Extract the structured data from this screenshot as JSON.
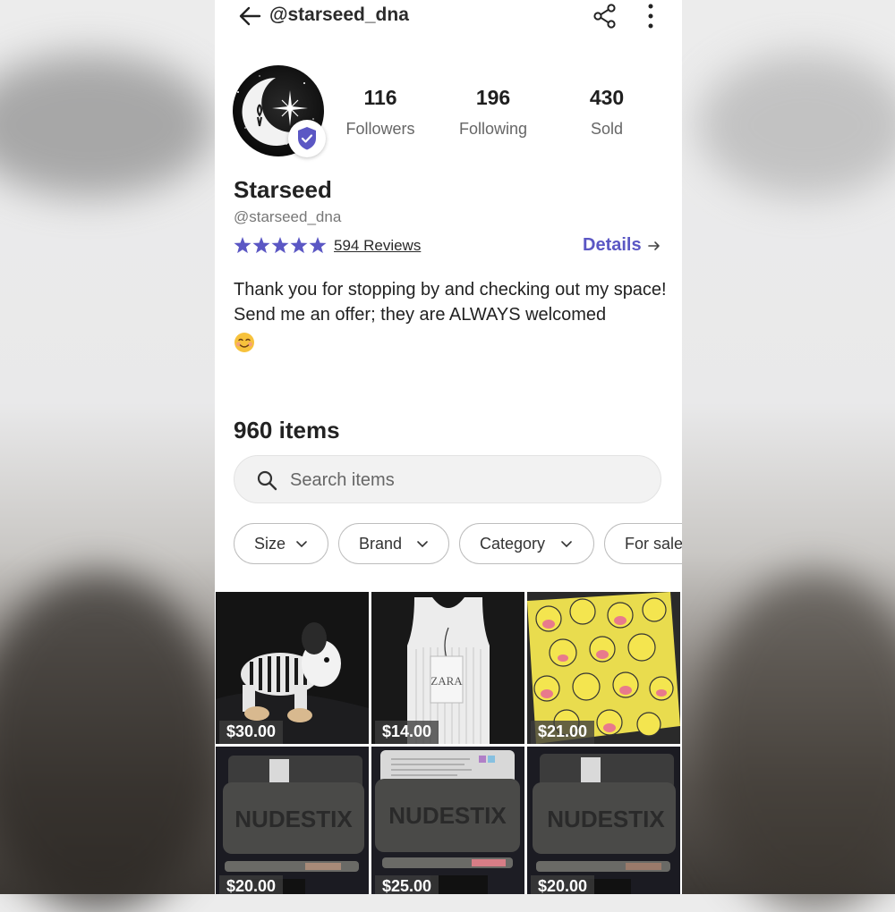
{
  "header": {
    "handle": "@starseed_dna"
  },
  "profile": {
    "stats": [
      {
        "value": "116",
        "label": "Followers"
      },
      {
        "value": "196",
        "label": "Following"
      },
      {
        "value": "430",
        "label": "Sold"
      }
    ],
    "name": "Starseed",
    "handle": "@starseed_dna",
    "rating": 5,
    "reviews_label": "594 Reviews",
    "details_label": "Details",
    "bio": "Thank you for stopping by and checking out my space! Send me an offer; they are ALWAYS welcomed",
    "accent_color": "#5b57c4",
    "verified": true
  },
  "items": {
    "count_label": "960 items",
    "search_placeholder": "Search items",
    "filters": [
      "Size",
      "Brand",
      "Category",
      "For sale"
    ],
    "listings": [
      {
        "price": "$30.00",
        "thumbnail": "skeleton-elephant-toy"
      },
      {
        "price": "$14.00",
        "thumbnail": "white-ribbed-tank-top"
      },
      {
        "price": "$21.00",
        "thumbnail": "yellow-smiley-print-fabric"
      },
      {
        "price": "$20.00",
        "thumbnail": "nudestix-tin"
      },
      {
        "price": "$25.00",
        "thumbnail": "nudestix-tin"
      },
      {
        "price": "$20.00",
        "thumbnail": "nudestix-tin"
      }
    ]
  },
  "icons": [
    "back-arrow-icon",
    "share-icon",
    "more-vertical-icon",
    "verified-shield-icon",
    "star-icon",
    "arrow-right-icon",
    "search-icon",
    "chevron-down-icon"
  ]
}
